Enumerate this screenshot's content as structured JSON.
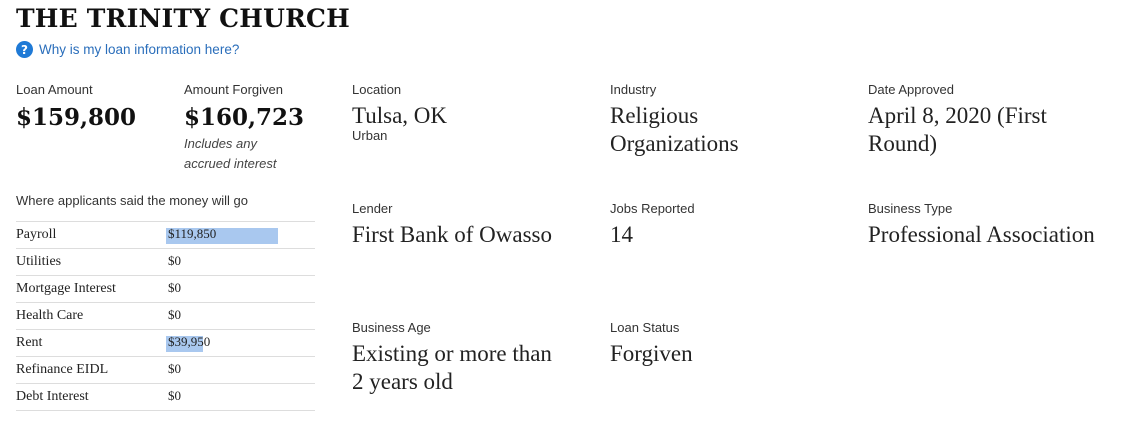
{
  "page": {
    "title": "THE TRINITY CHURCH",
    "help_link": "Why is my loan information here?",
    "help_icon": "question-circle-icon"
  },
  "loan": {
    "amount_label": "Loan Amount",
    "amount": "$159,800",
    "forgiven_label": "Amount Forgiven",
    "forgiven": "$160,723",
    "forgiven_note": "Includes any accrued interest"
  },
  "uses": {
    "heading": "Where applicants said the money will go",
    "max_value": 159800,
    "rows": [
      {
        "category": "Payroll",
        "amount": "$119,850",
        "value": 119850
      },
      {
        "category": "Utilities",
        "amount": "$0",
        "value": 0
      },
      {
        "category": "Mortgage Interest",
        "amount": "$0",
        "value": 0
      },
      {
        "category": "Health Care",
        "amount": "$0",
        "value": 0
      },
      {
        "category": "Rent",
        "amount": "$39,950",
        "value": 39950
      },
      {
        "category": "Refinance EIDL",
        "amount": "$0",
        "value": 0
      },
      {
        "category": "Debt Interest",
        "amount": "$0",
        "value": 0
      }
    ]
  },
  "details": {
    "location_label": "Location",
    "location": "Tulsa, OK",
    "location_sub": "Urban",
    "industry_label": "Industry",
    "industry": "Religious Organizations",
    "date_label": "Date Approved",
    "date": "April 8, 2020 (First Round)",
    "lender_label": "Lender",
    "lender": "First Bank of Owasso",
    "jobs_label": "Jobs Reported",
    "jobs": "14",
    "business_type_label": "Business Type",
    "business_type": "Professional Association",
    "business_age_label": "Business Age",
    "business_age": "Existing or more than 2 years old",
    "status_label": "Loan Status",
    "status": "Forgiven"
  },
  "colors": {
    "bar": "#a9c8ef",
    "link": "#2a6ebb",
    "help_icon_bg": "#1f7ad6"
  }
}
